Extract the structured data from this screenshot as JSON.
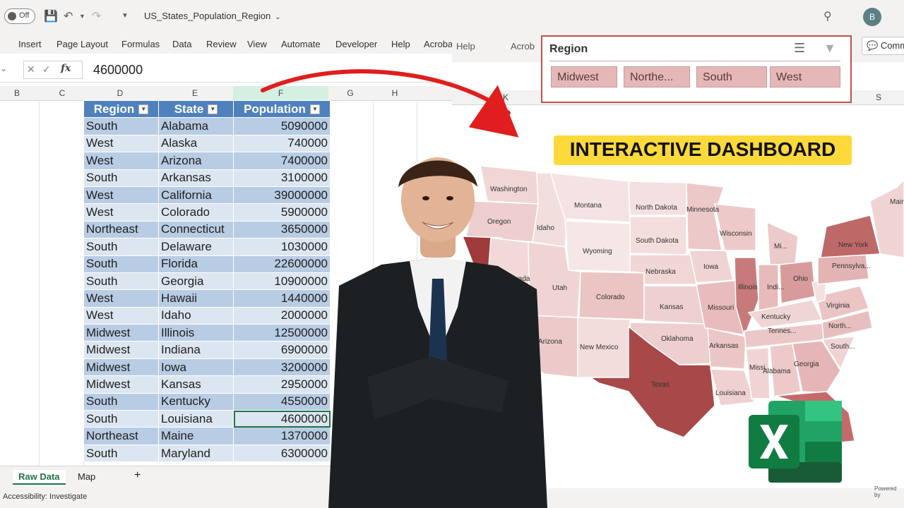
{
  "titlebar": {
    "autosave_label": "Off",
    "filename": "US_States_Population_Region",
    "avatar_initial": "B"
  },
  "ribbon_tabs": [
    "Insert",
    "Page Layout",
    "Formulas",
    "Data",
    "Review",
    "View",
    "Automate",
    "Developer",
    "Help",
    "Acrobat"
  ],
  "ribbon_tabs_right": [
    "Help",
    "Acrob"
  ],
  "comments_button": "Comm",
  "formula_bar": {
    "fx_label": "fx",
    "value": "4600000"
  },
  "column_headers": [
    "B",
    "C",
    "D",
    "E",
    "F",
    "G",
    "H"
  ],
  "column_headers_right": [
    "K",
    "S"
  ],
  "table": {
    "headers": [
      "Region",
      "State",
      "Population"
    ],
    "rows": [
      [
        "South",
        "Alabama",
        "5090000"
      ],
      [
        "West",
        "Alaska",
        "740000"
      ],
      [
        "West",
        "Arizona",
        "7400000"
      ],
      [
        "South",
        "Arkansas",
        "3100000"
      ],
      [
        "West",
        "California",
        "39000000"
      ],
      [
        "West",
        "Colorado",
        "5900000"
      ],
      [
        "Northeast",
        "Connecticut",
        "3650000"
      ],
      [
        "South",
        "Delaware",
        "1030000"
      ],
      [
        "South",
        "Florida",
        "22600000"
      ],
      [
        "South",
        "Georgia",
        "10900000"
      ],
      [
        "West",
        "Hawaii",
        "1440000"
      ],
      [
        "West",
        "Idaho",
        "2000000"
      ],
      [
        "Midwest",
        "Illinois",
        "12500000"
      ],
      [
        "Midwest",
        "Indiana",
        "6900000"
      ],
      [
        "Midwest",
        "Iowa",
        "3200000"
      ],
      [
        "Midwest",
        "Kansas",
        "2950000"
      ],
      [
        "South",
        "Kentucky",
        "4550000"
      ],
      [
        "South",
        "Louisiana",
        "4600000"
      ],
      [
        "Northeast",
        "Maine",
        "1370000"
      ],
      [
        "South",
        "Maryland",
        "6300000"
      ]
    ],
    "selected_row": 17
  },
  "sheet_tabs": {
    "active": "Raw Data",
    "other": "Map",
    "add": "+"
  },
  "status": {
    "accessibility": "Accessibility: Investigate"
  },
  "slicer": {
    "title": "Region",
    "buttons": [
      "Midwest",
      "Northe...",
      "South",
      "West"
    ]
  },
  "banner": "INTERACTIVE DASHBOARD",
  "map_labels": {
    "washington": "Washington",
    "oregon": "Oregon",
    "idaho": "Idaho",
    "montana": "Montana",
    "north_dakota": "North Dakota",
    "south_dakota": "South Dakota",
    "minnesota": "Minnesota",
    "wisconsin": "Wisconsin",
    "wyoming": "Wyoming",
    "nevada": "Nevada",
    "utah": "Utah",
    "colorado": "Colorado",
    "nebraska": "Nebraska",
    "kansas": "Kansas",
    "iowa": "Iowa",
    "missouri": "Missouri",
    "illinois": "Illinois",
    "indiana": "Indi...",
    "ohio": "Ohio",
    "michigan": "Mi...",
    "new_york": "New York",
    "pennsylvania": "Pennsylva...",
    "maine": "Main",
    "virginia": "Virginia",
    "kentucky": "Kentucky",
    "tennessee": "Tennes...",
    "north_carolina": "North...",
    "south_carolina": "South...",
    "georgia": "Georgia",
    "alabama": "Alabama",
    "mississippi": "Missi...",
    "louisiana": "Louisiana",
    "arkansas": "Arkansas",
    "oklahoma": "Oklahoma",
    "texas": "Texas",
    "new_mexico": "New Mexico",
    "arizona": "Arizona"
  },
  "powered_by": "Powered by",
  "colors": {
    "excel_green": "#217346",
    "table_header": "#4f81bd",
    "slicer_button": "#e5b8b7",
    "banner": "#fdd93a",
    "arrow": "#e01e1e"
  }
}
